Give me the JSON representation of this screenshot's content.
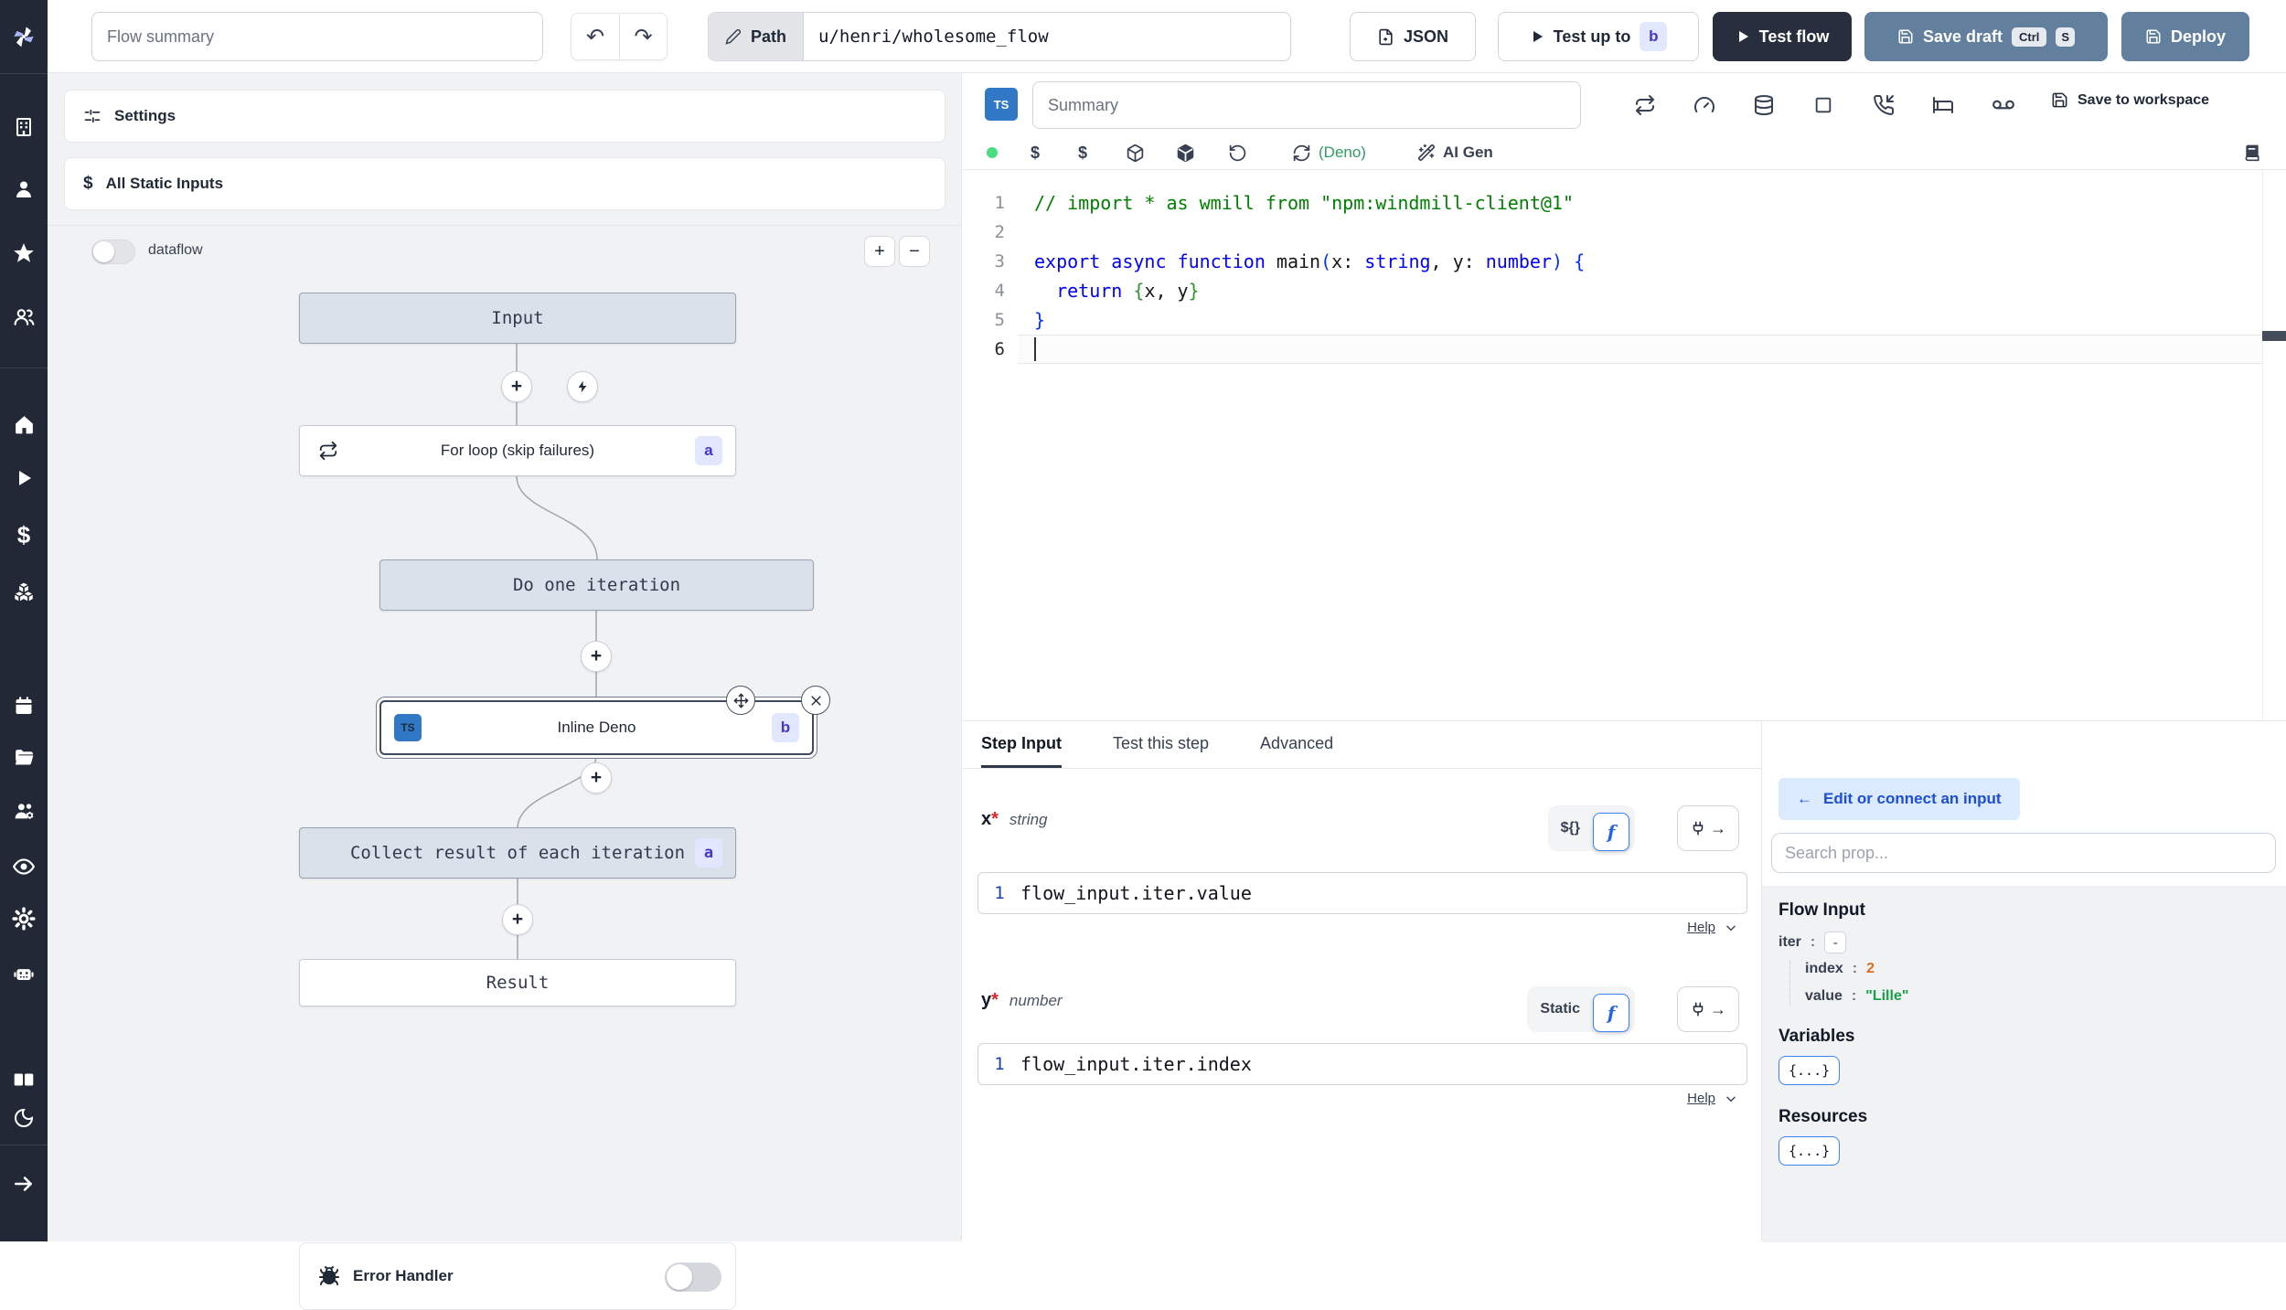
{
  "topbar": {
    "flow_summary_placeholder": "Flow summary",
    "undo_glyph": "↶",
    "redo_glyph": "↷",
    "path_label": "Path",
    "path_value": "u/henri/wholesome_flow",
    "json_label": "JSON",
    "test_up_to_label": "Test up to",
    "test_up_to_badge": "b",
    "test_flow_label": "Test flow",
    "save_draft_label": "Save draft",
    "kbd": [
      "Ctrl",
      "S"
    ],
    "deploy_label": "Deploy"
  },
  "sidebar": {
    "icons": [
      "windmill-logo",
      "building",
      "user",
      "star",
      "users",
      "home",
      "play",
      "dollar",
      "boxes",
      "calendar",
      "folder-open",
      "users-settings",
      "eye",
      "gear",
      "robot",
      "books",
      "moon",
      "collapse-arrow"
    ],
    "dollar_glyph": "$"
  },
  "flow_panel": {
    "settings_label": "Settings",
    "static_inputs_label": "All Static Inputs",
    "dollar_glyph": "$",
    "dataflow_label": "dataflow",
    "zoom_in_glyph": "+",
    "zoom_out_glyph": "−",
    "plus_glyph": "+",
    "nodes": {
      "input_label": "Input",
      "forloop_label": "For loop (skip failures)",
      "forloop_badge": "a",
      "iteration_label": "Do one iteration",
      "step_label": "Inline Deno",
      "step_badge": "b",
      "step_lang": "TS",
      "collect_label": "Collect result of each iteration",
      "collect_badge": "a",
      "result_label": "Result"
    },
    "error_handler_label": "Error Handler"
  },
  "editor": {
    "lang_badge": "TS",
    "summary_placeholder": "Summary",
    "save_to_workspace_label": "Save to workspace",
    "dollar_glyph": "$",
    "deno_label": "(Deno)",
    "ai_gen_label": "AI Gen",
    "active_line": 6,
    "code": [
      [
        [
          "// import * as wmill from \"npm:windmill-client@1\"",
          "cmt"
        ]
      ],
      [],
      [
        [
          "export",
          "kw"
        ],
        [
          " ",
          "pl"
        ],
        [
          "async",
          "kw"
        ],
        [
          " ",
          "pl"
        ],
        [
          "function",
          "kw"
        ],
        [
          " main",
          "pl"
        ],
        [
          "(",
          "b1"
        ],
        [
          "x: ",
          "pl"
        ],
        [
          "string",
          "kw"
        ],
        [
          ", y: ",
          "pl"
        ],
        [
          "number",
          "kw"
        ],
        [
          ")",
          "b1"
        ],
        [
          " ",
          "pl"
        ],
        [
          "{",
          "b1"
        ]
      ],
      [
        [
          "  ",
          "pl"
        ],
        [
          "return",
          "kw"
        ],
        [
          " ",
          "pl"
        ],
        [
          "{",
          "b2"
        ],
        [
          "x, y",
          "pl"
        ],
        [
          "}",
          "b2"
        ]
      ],
      [
        [
          "}",
          "b1"
        ]
      ],
      []
    ]
  },
  "step_panel": {
    "tabs": [
      "Step Input",
      "Test this step",
      "Advanced"
    ],
    "fields": [
      {
        "name": "x",
        "required_glyph": "*",
        "type": "string",
        "mode_alt": "${}",
        "mode_fn": "f",
        "line_no": "1",
        "expr": "flow_input.iter.value",
        "help_label": "Help"
      },
      {
        "name": "y",
        "required_glyph": "*",
        "type": "number",
        "mode_alt": "Static",
        "mode_fn": "f",
        "line_no": "1",
        "expr": "flow_input.iter.index",
        "help_label": "Help"
      }
    ],
    "plug_arrow_glyph": "→"
  },
  "prop_picker": {
    "back_arrow_glyph": "←",
    "edit_connect_label": "Edit or connect an input",
    "search_placeholder": "Search prop...",
    "flow_input_title": "Flow Input",
    "sep_glyph": ":",
    "tree": {
      "iter_key": "iter",
      "iter_collapse_glyph": "-",
      "index_key": "index",
      "index_value": "2",
      "value_key": "value",
      "value_value": "\"Lille\""
    },
    "variables_title": "Variables",
    "resources_title": "Resources",
    "object_glyph": "{...}"
  },
  "colors": {
    "ts_blue": "#3178c6",
    "badge_bg": "#e0e7ff",
    "badge_text": "#4338ca",
    "primary_button_blue": "#62809e",
    "dark_button": "#272e3d",
    "status_green": "#4ade80",
    "deno_green": "#2f9e63",
    "index_orange": "#dd6b20",
    "string_green": "#16a34a",
    "link_blue": "#1d4ed8",
    "connect_bg": "#dbeafe",
    "node_gray_bg": "#dbe1ea"
  }
}
